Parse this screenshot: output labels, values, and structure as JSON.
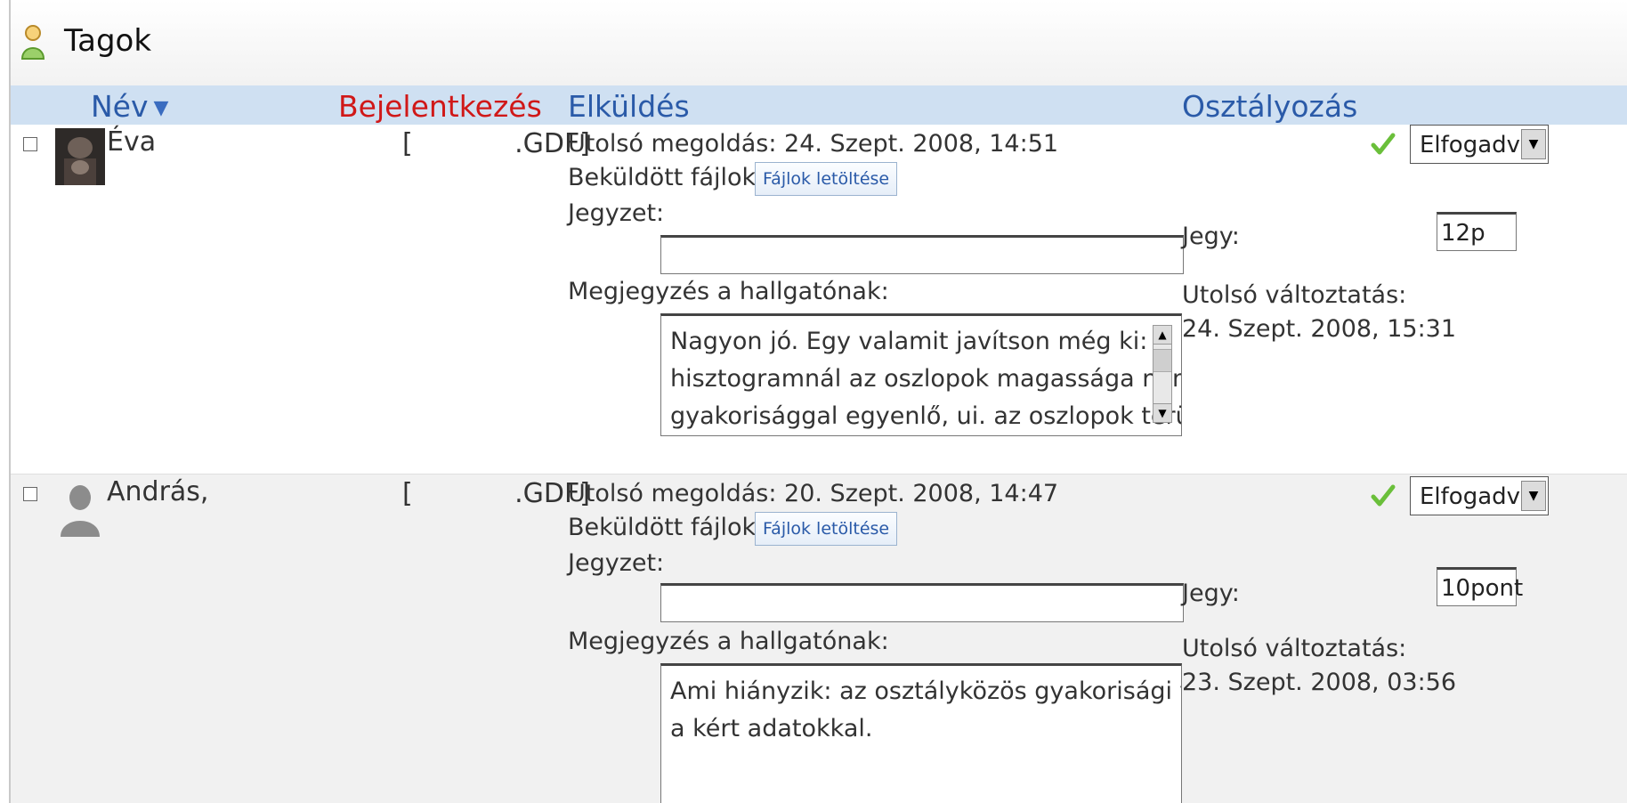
{
  "section": {
    "title": "Tagok"
  },
  "columns": {
    "name": "Név",
    "login": "Bejelentkezés",
    "submission": "Elküldés",
    "grading": "Osztályozás"
  },
  "rows": [
    {
      "name": "Éva",
      "login": "[            .GDF]",
      "last_solution": "Utolsó megoldás: 24. Szept. 2008, 14:51",
      "files_label": "Beküldött fájlok: 2",
      "download_button": "Fájlok letöltése",
      "note_label": "Jegyzet:",
      "note_value": "",
      "comment_label": "Megjegyzés a hallgatónak:",
      "comment_lines": [
        "Nagyon jó. Egy valamit javítson még ki:",
        "hisztogramnál az oszlopok magassága nem a",
        "gyakorisággal egyenlő, ui. az oszlopok területe"
      ],
      "status": "Elfogadva",
      "grade_label": "Jegy:",
      "grade_value": "12p",
      "changed_label": "Utolsó változtatás:",
      "changed_value": "24. Szept. 2008, 15:31"
    },
    {
      "name": "András,",
      "login": "[            .GDF]",
      "last_solution": "Utolsó megoldás: 20. Szept. 2008, 14:47",
      "files_label": "Beküldött fájlok: 1",
      "download_button": "Fájlok letöltése",
      "note_label": "Jegyzet:",
      "note_value": "",
      "comment_label": "Megjegyzés a hallgatónak:",
      "comment_lines": [
        "Ami hiányzik: az osztályközös gyakorisági táblázat",
        "a kért adatokkal."
      ],
      "status": "Elfogadva",
      "grade_label": "Jegy:",
      "grade_value": "10pont",
      "changed_label": "Utolsó változtatás:",
      "changed_value": "23. Szept. 2008, 03:56"
    }
  ],
  "icons": {
    "title": "user-group-icon",
    "sort": "sort-down-icon",
    "status": "checkmark-icon",
    "avatar_1": "user-photo-avatar",
    "avatar_2": "default-user-avatar"
  }
}
